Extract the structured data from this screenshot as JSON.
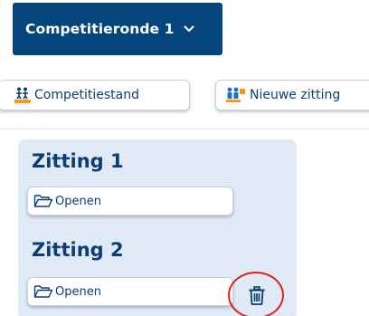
{
  "round_selector": {
    "label": "Competitieronde 1",
    "icon": "chevron-down-icon"
  },
  "toolbar": {
    "standings_label": "Competitiestand",
    "standings_icon": "standings-podium-icon",
    "new_session_label": "Nieuwe zitting",
    "new_session_icon": "group-add-icon"
  },
  "sessions": [
    {
      "title": "Zitting 1",
      "open_label": "Openen",
      "open_icon": "folder-open-icon"
    },
    {
      "title": "Zitting 2",
      "open_label": "Openen",
      "open_icon": "folder-open-icon",
      "delete_icon": "trash-icon"
    }
  ],
  "colors": {
    "primary": "#04457c",
    "text": "#0d3d72",
    "panel": "#dfeaf6",
    "highlight": "#e0201b",
    "accent_orange": "#f39a1e"
  }
}
